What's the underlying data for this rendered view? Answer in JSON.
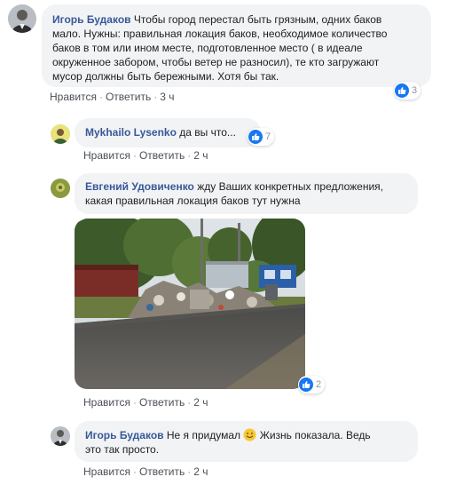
{
  "comments": [
    {
      "author": "Игорь Будаков",
      "text_lines": [
        "Чтобы город перестал быть грязным, одних баков",
        "мало. Нужны: правильная локация баков, необходимое количество",
        "баков в том или ином месте, подготовленное место ( в идеале",
        "окруженное забором, чтобы ветер не разносил), те кто загружают",
        "мусор должны быть бережными. Хотя бы так."
      ],
      "like_label": "Нравится",
      "reply_label": "Ответить",
      "time": "3 ч",
      "reaction_count": "3"
    },
    {
      "author": "Mykhailo Lysenko",
      "text": "да вы что...",
      "like_label": "Нравится",
      "reply_label": "Ответить",
      "time": "2 ч",
      "reaction_count": "7"
    },
    {
      "author": "Евгений Удовиченко",
      "text_lines": [
        "жду Ваших конкретных предложения,",
        "какая правильная локация баков тут нужна"
      ],
      "like_label": "Нравится",
      "reply_label": "Ответить",
      "time": "2 ч",
      "reaction_count": "2"
    },
    {
      "author": "Игорь Будаков",
      "text_before_emoji": "Не я придумал",
      "text_after_emoji": "Жизнь показала. Ведь",
      "text_line2": "это так просто.",
      "like_label": "Нравится",
      "reply_label": "Ответить",
      "time": "2 ч"
    }
  ],
  "icons": {
    "like": "thumbs-up-icon",
    "smile": "smile-emoji-icon"
  },
  "colors": {
    "author": "#385898",
    "bubble": "#f2f3f5",
    "like_blue": "#1877f2",
    "meta": "#90949c"
  }
}
